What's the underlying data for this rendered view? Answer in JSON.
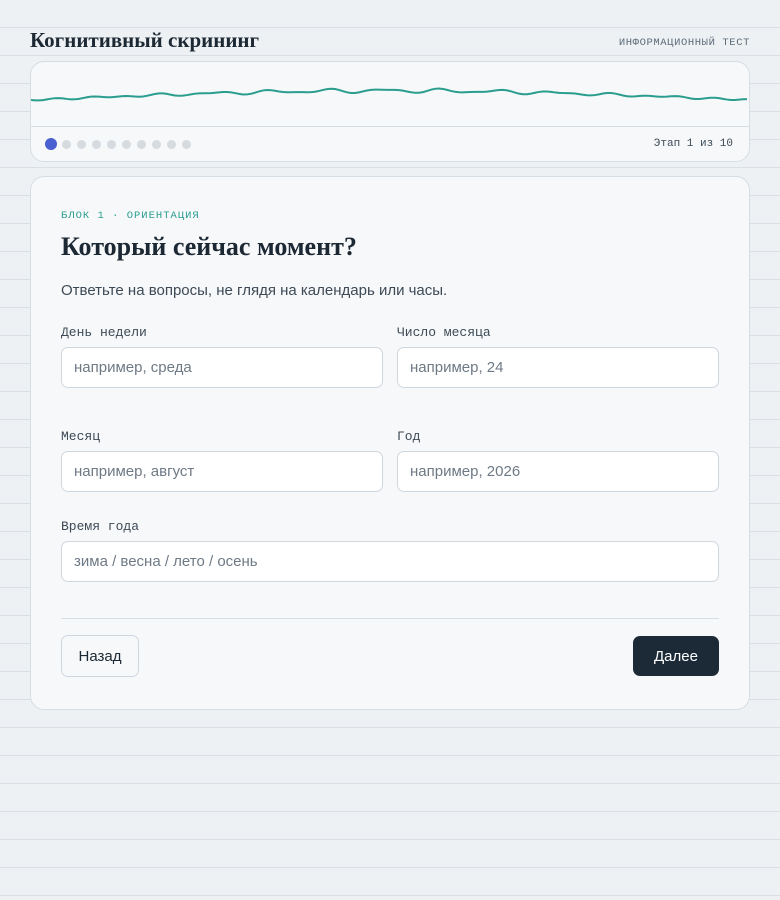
{
  "header": {
    "title": "Когнитивный скрининг",
    "subtitle": "ИНФОРМАЦИОННЫЙ ТЕСТ"
  },
  "progress": {
    "current_step": 1,
    "total_steps": 10,
    "step_text": "Этап 1 из 10",
    "wave_color": "#2a9d8f",
    "active_dot_color": "#4a5fd0"
  },
  "form": {
    "block_label": "БЛОК 1 · ОРИЕНТАЦИЯ",
    "title": "Который сейчас момент?",
    "instructions": "Ответьте на вопросы, не глядя на календарь или часы.",
    "fields": [
      {
        "label": "День недели",
        "placeholder": "например, среда",
        "value": ""
      },
      {
        "label": "Число месяца",
        "placeholder": "например, 24",
        "value": ""
      },
      {
        "label": "Месяц",
        "placeholder": "например, август",
        "value": ""
      },
      {
        "label": "Год",
        "placeholder": "например, 2026",
        "value": ""
      },
      {
        "label": "Время года",
        "placeholder": "зима / весна / лето / осень",
        "value": ""
      }
    ],
    "back_label": "Назад",
    "next_label": "Далее"
  },
  "colors": {
    "accent": "#2a9d8f",
    "primary_button": "#1c2a38",
    "background": "#edf1f4"
  }
}
